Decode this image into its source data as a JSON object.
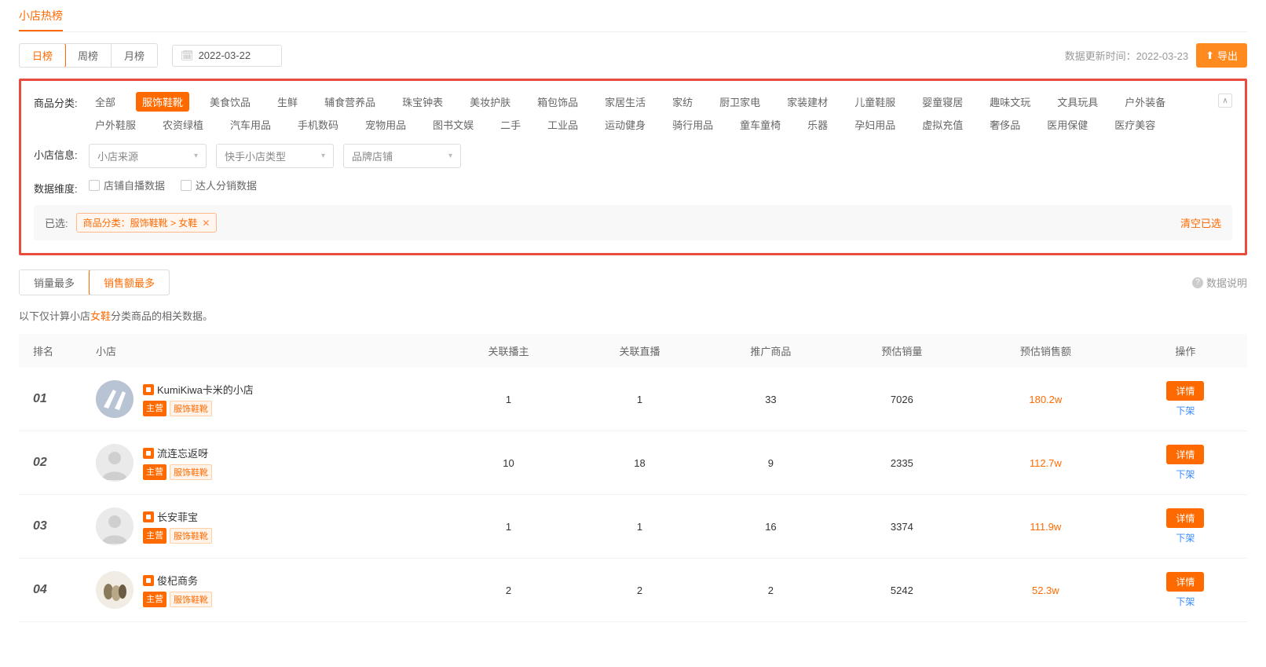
{
  "header": {
    "tab": "小店热榜"
  },
  "period": {
    "tabs": [
      "日榜",
      "周榜",
      "月榜"
    ],
    "activeIndex": 0,
    "date": "2022-03-22",
    "updateLabel": "数据更新时间：",
    "updateTime": "2022-03-23",
    "exportLabel": "导出"
  },
  "filters": {
    "categoryLabel": "商品分类:",
    "categories": [
      "全部",
      "服饰鞋靴",
      "美食饮品",
      "生鲜",
      "辅食营养品",
      "珠宝钟表",
      "美妆护肤",
      "箱包饰品",
      "家居生活",
      "家纺",
      "厨卫家电",
      "家装建材",
      "儿童鞋服",
      "婴童寝居",
      "趣味文玩",
      "文具玩具",
      "户外装备",
      "户外鞋服",
      "农资绿植",
      "汽车用品",
      "手机数码",
      "宠物用品",
      "图书文娱",
      "二手",
      "工业品",
      "运动健身",
      "骑行用品",
      "童车童椅",
      "乐器",
      "孕妇用品",
      "虚拟充值",
      "奢侈品",
      "医用保健",
      "医疗美容"
    ],
    "categoryActiveIndex": 1,
    "shopInfoLabel": "小店信息:",
    "selects": [
      "小店来源",
      "快手小店类型",
      "品牌店铺"
    ],
    "dimLabel": "数据维度:",
    "checkboxes": [
      "店铺自播数据",
      "达人分销数据"
    ],
    "selectedLabel": "已选:",
    "selectedTag": "商品分类：服饰鞋靴 > 女鞋",
    "clearLabel": "清空已选"
  },
  "sort": {
    "tabs": [
      "销量最多",
      "销售额最多"
    ],
    "activeIndex": 1,
    "dataNote": "数据说明"
  },
  "noteLine": {
    "prefix": "以下仅计算小店",
    "highlight": "女鞋",
    "suffix": "分类商品的相关数据。"
  },
  "table": {
    "headers": [
      "排名",
      "小店",
      "关联播主",
      "关联直播",
      "推广商品",
      "预估销量",
      "预估销售额",
      "操作"
    ],
    "detailBtn": "详情",
    "offShelf": "下架",
    "tagMain": "主营",
    "tagCategory": "服饰鞋靴",
    "rows": [
      {
        "rank": "01",
        "name": "KumiKiwa卡米的小店",
        "anchor": "1",
        "live": "1",
        "goods": "33",
        "volume": "7026",
        "sales": "180.2w",
        "avatar": "shoes1"
      },
      {
        "rank": "02",
        "name": "流连忘返呀",
        "anchor": "10",
        "live": "18",
        "goods": "9",
        "volume": "2335",
        "sales": "112.7w",
        "avatar": "default"
      },
      {
        "rank": "03",
        "name": "长安菲宝",
        "anchor": "1",
        "live": "1",
        "goods": "16",
        "volume": "3374",
        "sales": "111.9w",
        "avatar": "default"
      },
      {
        "rank": "04",
        "name": "俊杞商务",
        "anchor": "2",
        "live": "2",
        "goods": "2",
        "volume": "5242",
        "sales": "52.3w",
        "avatar": "shoes2"
      }
    ]
  }
}
